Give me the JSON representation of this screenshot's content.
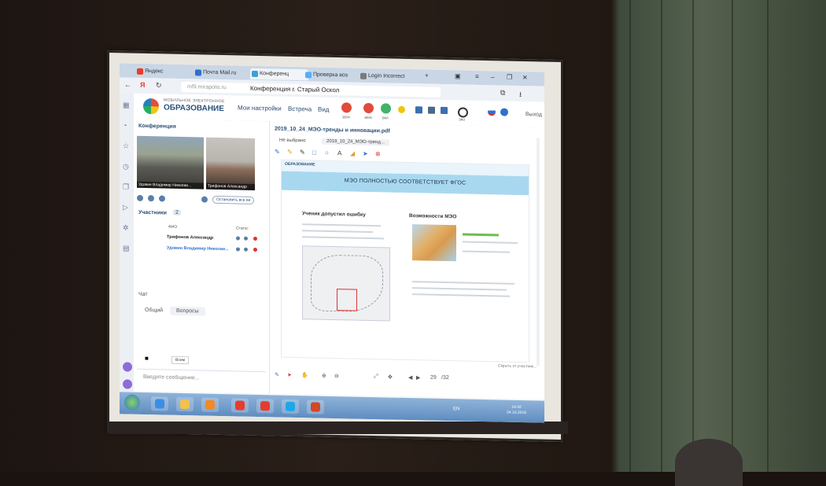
{
  "browser": {
    "tabs": [
      {
        "label": "Яндекс",
        "color": "#e63c2e"
      },
      {
        "label": "Почта Mail.ru",
        "color": "#2f6fcf"
      },
      {
        "label": "Конференц",
        "color": "#3aa0d8"
      },
      {
        "label": "Проверка воз",
        "color": "#4fb0ff"
      },
      {
        "label": "Login Incorrect",
        "color": "#7a7a7a"
      }
    ],
    "url": "mf9.mirapolis.ru",
    "page_title": "Конференция г. Старый Оскол"
  },
  "app": {
    "logo_small": "МОБИЛЬНОЕ ЭЛЕКТРОННОЕ",
    "logo_big": "ОБРАЗОВАНИЕ",
    "menu": [
      "Мои настройки",
      "Встреча",
      "Вид"
    ],
    "toolbar_labels": [
      "ЗВУК",
      "ЗВУК",
      "ВКЛ",
      "ЭКО"
    ],
    "exit": "Выход"
  },
  "conference": {
    "title": "Конференция",
    "videos": [
      {
        "label": "Удовин Владимир Николае..."
      },
      {
        "label": "Трифонов Александр"
      }
    ],
    "stop_all": "Остановить все ви",
    "participants_title": "Участники",
    "participants_count": "2",
    "columns": [
      "ФИО",
      "Статус"
    ],
    "participants": [
      {
        "name": "Трифонов Александр",
        "color": "#222222"
      },
      {
        "name": "Удовин Владимир Николае...",
        "color": "#2f6fcf"
      }
    ],
    "chat_title": "Чат",
    "chat_tabs": [
      "Общий",
      "Вопросы"
    ],
    "chat_recipient": "Всем",
    "chat_placeholder": "Введите сообщение..."
  },
  "document": {
    "title": "2019_10_24_МЭО-тренды и инновации.pdf",
    "tabs": [
      "Не выбрано",
      "2019_10_24_МЭО-тренд..."
    ],
    "slide_logo": "ОБРАЗОВАНИЕ",
    "banner": "МЭО ПОЛНОСТЬЮ СООТВЕТСТВУЕТ ФГОС",
    "left_heading": "Ученик допустил ошибку",
    "right_heading": "Возможности МЭО",
    "page_current": "29",
    "page_total": "/32",
    "hide_participants": "Скрыть от участник..."
  },
  "taskbar": {
    "lang": "EN",
    "time": "14:42",
    "date": "24.10.2019",
    "apps": [
      {
        "name": "ie",
        "color": "#3a8ee6"
      },
      {
        "name": "explorer",
        "color": "#f2c14e"
      },
      {
        "name": "media",
        "color": "#f08a24"
      },
      {
        "name": "yandex",
        "color": "#e63c2e"
      },
      {
        "name": "yandex-browser",
        "color": "#e63c2e"
      },
      {
        "name": "skype",
        "color": "#1ea7e8"
      },
      {
        "name": "powerpoint",
        "color": "#d24726"
      }
    ]
  }
}
